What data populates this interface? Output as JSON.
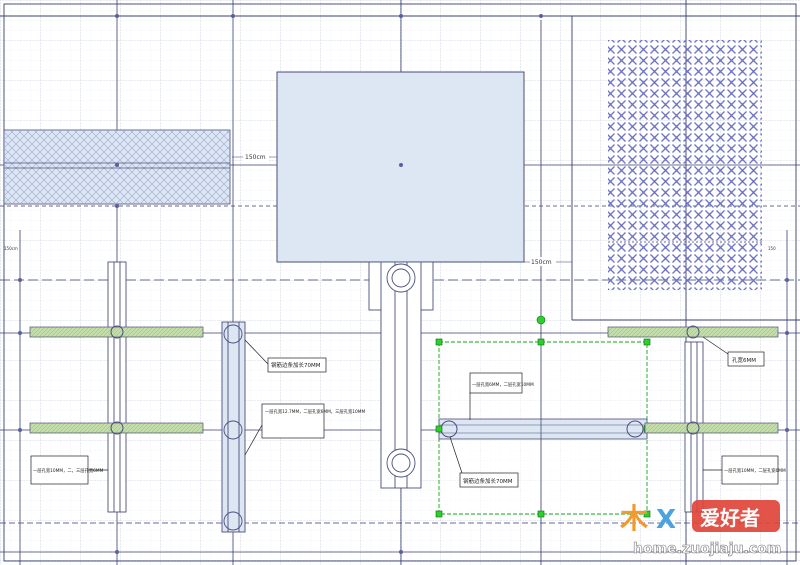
{
  "colors": {
    "background": "#ffffff",
    "grid": "#c9cfe0",
    "guide": "#3a3f6e",
    "part_fill": "#dde6f3",
    "part_stroke": "#4a4f7a",
    "hatch": "#7d82c9",
    "rail_green": "#b9d79e",
    "selection": "#16a516",
    "watermark_orange": "#f29a2e",
    "watermark_blue": "#4aa3df",
    "watermark_red": "#e0453a"
  },
  "dimensions": {
    "top_gap": "150cm",
    "right_gap": "150cm",
    "left_small": "150cm",
    "right_small": "150"
  },
  "callouts": {
    "bar_hole_spacing_a": "钢筋边条加长70MM",
    "bar_hole_spacing_b": "一层孔宽12.7MM，二层孔宽6MM，三层孔宽10MM",
    "left_bottom": "一层孔宽10MM，二，三层孔宽6MM",
    "selected_top": "一层孔宽6MM，二层孔宽10MM",
    "selected_bottom": "钢筋边条加长70MM",
    "right_top": "孔宽6MM",
    "right_bottom": "一层孔宽10MM，二层孔宽6MM"
  },
  "watermark": {
    "logo_text": "木",
    "logo_mid": "X",
    "logo_badge": "爱好者",
    "url": "home.zuojiaju.com"
  },
  "icons": {
    "rotate_handle": "rotate-handle-icon",
    "selection_handle": "selection-handle-icon",
    "connection_point": "connection-point-icon"
  }
}
